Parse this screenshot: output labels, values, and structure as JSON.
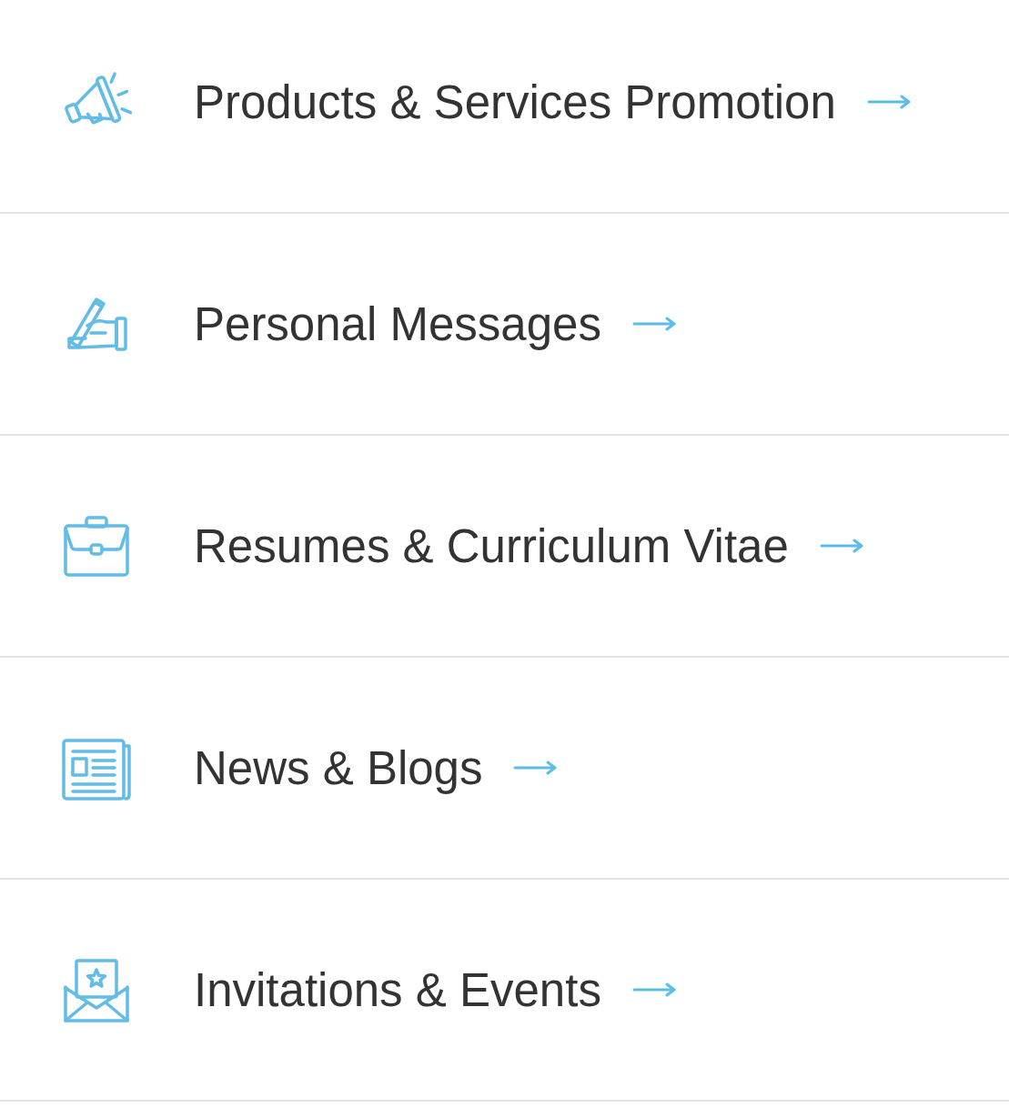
{
  "categories": [
    {
      "kind": "promotion",
      "label": "Products & Services Promotion"
    },
    {
      "kind": "personal",
      "label": "Personal Messages"
    },
    {
      "kind": "resume",
      "label": "Resumes & Curriculum Vitae"
    },
    {
      "kind": "news",
      "label": "News & Blogs"
    },
    {
      "kind": "invitation",
      "label": "Invitations & Events"
    }
  ]
}
